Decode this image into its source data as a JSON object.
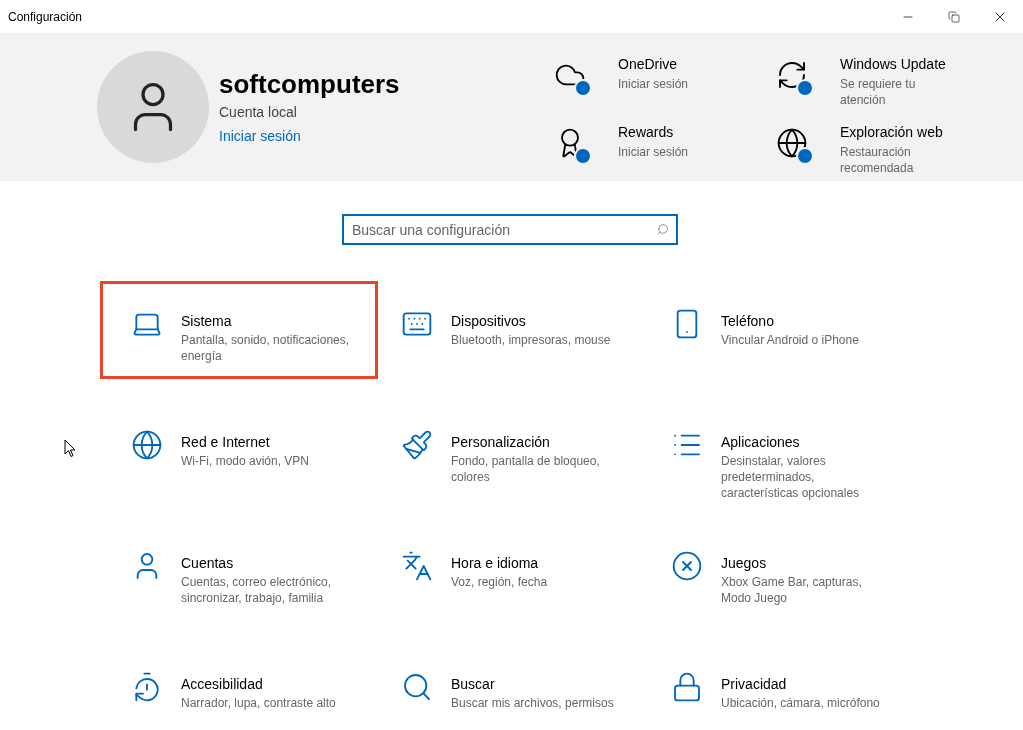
{
  "window": {
    "title": "Configuración"
  },
  "account": {
    "name": "softcomputers",
    "type": "Cuenta local",
    "link": "Iniciar sesión"
  },
  "services": [
    {
      "title": "OneDrive",
      "subtitle": "Iniciar sesión"
    },
    {
      "title": "Windows Update",
      "subtitle": "Se requiere tu atención"
    },
    {
      "title": "Rewards",
      "subtitle": "Iniciar sesión"
    },
    {
      "title": "Exploración web",
      "subtitle": "Restauración recomendada"
    }
  ],
  "search": {
    "placeholder": "Buscar una configuración"
  },
  "categories": [
    {
      "title": "Sistema",
      "subtitle": "Pantalla, sonido, notificaciones, energía",
      "highlighted": true
    },
    {
      "title": "Dispositivos",
      "subtitle": "Bluetooth, impresoras, mouse",
      "highlighted": false
    },
    {
      "title": "Teléfono",
      "subtitle": "Vincular Android o iPhone",
      "highlighted": false
    },
    {
      "title": "Red e Internet",
      "subtitle": "Wi-Fi, modo avión, VPN",
      "highlighted": false
    },
    {
      "title": "Personalización",
      "subtitle": "Fondo, pantalla de bloqueo, colores",
      "highlighted": false
    },
    {
      "title": "Aplicaciones",
      "subtitle": "Desinstalar, valores predeterminados, características opcionales",
      "highlighted": false
    },
    {
      "title": "Cuentas",
      "subtitle": "Cuentas, correo electrónico, sincronizar, trabajo, familia",
      "highlighted": false
    },
    {
      "title": "Hora e idioma",
      "subtitle": "Voz, región, fecha",
      "highlighted": false
    },
    {
      "title": "Juegos",
      "subtitle": "Xbox Game Bar, capturas, Modo Juego",
      "highlighted": false
    },
    {
      "title": "Accesibilidad",
      "subtitle": "Narrador, lupa, contraste alto",
      "highlighted": false
    },
    {
      "title": "Buscar",
      "subtitle": "Buscar mis archivos, permisos",
      "highlighted": false
    },
    {
      "title": "Privacidad",
      "subtitle": "Ubicación, cámara, micrófono",
      "highlighted": false
    }
  ]
}
